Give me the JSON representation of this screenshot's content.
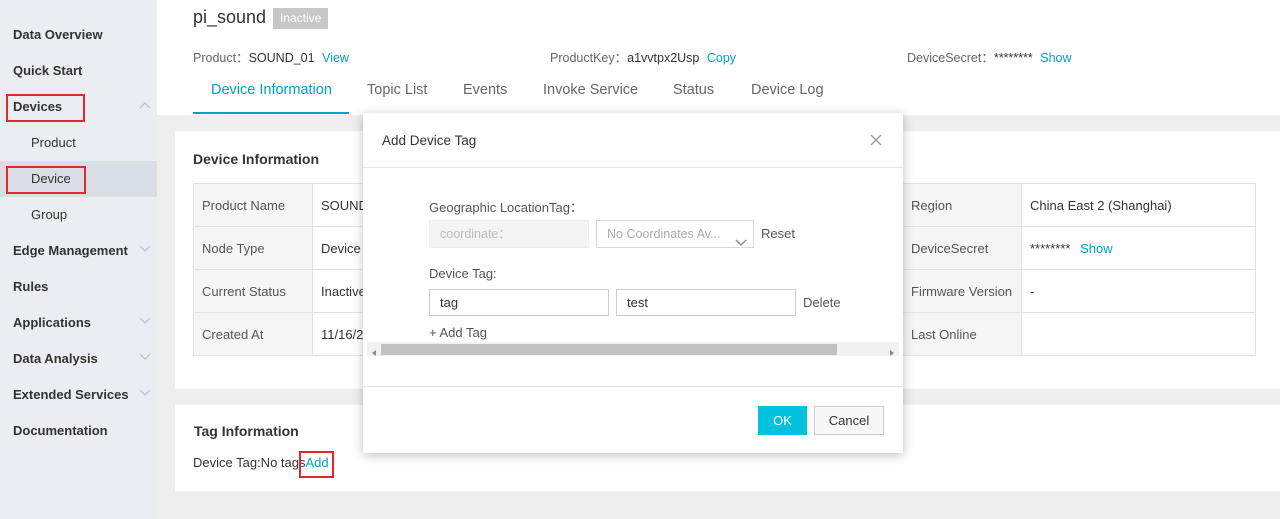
{
  "sidebar": {
    "items": [
      {
        "label": "Data Overview"
      },
      {
        "label": "Quick Start"
      },
      {
        "label": "Devices"
      },
      {
        "label": "Product"
      },
      {
        "label": "Device"
      },
      {
        "label": "Group"
      },
      {
        "label": "Edge Management"
      },
      {
        "label": "Rules"
      },
      {
        "label": "Applications"
      },
      {
        "label": "Data Analysis"
      },
      {
        "label": "Extended Services"
      },
      {
        "label": "Documentation"
      }
    ]
  },
  "header": {
    "device_name": "pi_sound",
    "status_badge": "Inactive",
    "product_label": "Product：",
    "product_value": "SOUND_01",
    "product_link": "View",
    "productkey_label": "ProductKey：",
    "productkey_value": "a1vvtpx2Usp",
    "productkey_link": "Copy",
    "devicesecret_label": "DeviceSecret：",
    "devicesecret_value": "********",
    "devicesecret_link": "Show"
  },
  "tabs": [
    "Device Information",
    "Topic List",
    "Events",
    "Invoke Service",
    "Status",
    "Device Log"
  ],
  "device_info": {
    "title": "Device Information",
    "rows": [
      {
        "k1": "Product Name",
        "v1": "SOUND",
        "k3": "Region",
        "v3": "China East 2 (Shanghai)"
      },
      {
        "k1": "Node Type",
        "v1": "Device",
        "k3": "DeviceSecret",
        "v3": "********",
        "v3_link": "Show"
      },
      {
        "k1": "Current Status",
        "v1": "Inactive",
        "k3": "Firmware Version",
        "v3": "-"
      },
      {
        "k1": "Created At",
        "v1": "11/16/2",
        "k3": "Last Online",
        "v3": ""
      }
    ]
  },
  "tag_info": {
    "title": "Tag Information",
    "text": "Device Tag:No tags",
    "add_link": "Add"
  },
  "modal": {
    "title": "Add Device Tag",
    "geo_label": "Geographic LocationTag：",
    "coord_placeholder": "coordinate：",
    "select_value": "No Coordinates Av...",
    "reset_link": "Reset",
    "device_tag_label": "Device Tag:",
    "tag_key": "tag",
    "tag_value": "test",
    "delete_link": "Delete",
    "add_tag_link": "+ Add Tag",
    "ok_label": "OK",
    "cancel_label": "Cancel"
  },
  "colors": {
    "accent": "#00a2ca",
    "ok_button": "#00c1de",
    "highlight": "#e0292b"
  }
}
